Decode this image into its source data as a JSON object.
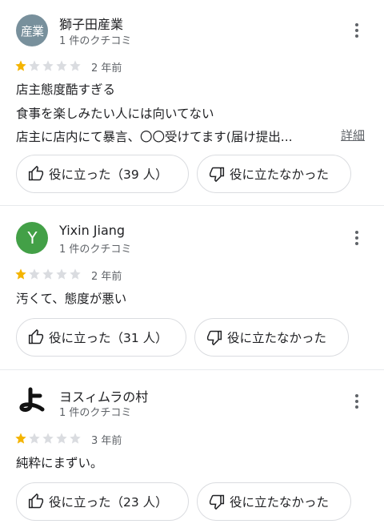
{
  "colors": {
    "star_filled": "#f4b400",
    "star_empty": "#dadce0",
    "avatar_1": "#78909c",
    "avatar_2": "#43a047"
  },
  "icons": {
    "more": "more-vert-icon",
    "helpful": "thumb-up-icon",
    "not_helpful": "thumb-down-icon",
    "star": "star-icon"
  },
  "reviews": [
    {
      "avatar_text": "産業",
      "name": "獅子田産業",
      "review_count": "1 件のクチコミ",
      "rating": 1,
      "date": "2 年前",
      "lines": [
        "店主態度酷すぎる",
        "食事を楽しみたい人には向いてない",
        "店主に店内にて暴言、〇〇受けてます(届け提出..."
      ],
      "detail_label": "詳細",
      "helpful_label": "役に立った（39 人）",
      "not_helpful_label": "役に立たなかった"
    },
    {
      "avatar_text": "Y",
      "name": "Yixin Jiang",
      "review_count": "1 件のクチコミ",
      "rating": 1,
      "date": "2 年前",
      "lines": [
        "汚くて、態度が悪い"
      ],
      "helpful_label": "役に立った（31 人）",
      "not_helpful_label": "役に立たなかった"
    },
    {
      "avatar_text": "よ",
      "name": "ヨスィムラの村",
      "review_count": "1 件のクチコミ",
      "rating": 1,
      "date": "3 年前",
      "lines": [
        "純粋にまずい。"
      ],
      "helpful_label": "役に立った（23 人）",
      "not_helpful_label": "役に立たなかった"
    }
  ]
}
